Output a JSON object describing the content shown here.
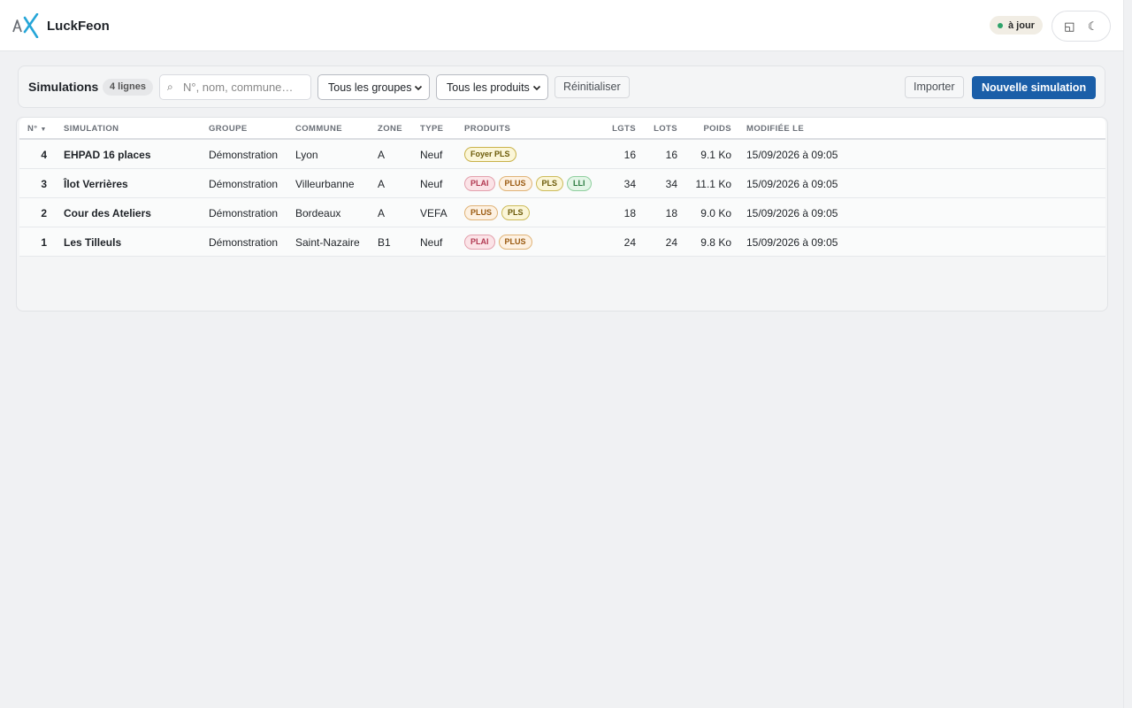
{
  "app": {
    "name": "LuckFeon"
  },
  "header": {
    "status": "à jour",
    "status_color": "#2ea36a",
    "icons": [
      "layout-icon",
      "moon-icon"
    ]
  },
  "toolbar": {
    "title": "Simulations",
    "count": "4 lignes",
    "search_placeholder": "N°, nom, commune…",
    "group_filter": "Tous les groupes",
    "product_filter": "Tous les produits",
    "reset_label": "Réinitialiser",
    "import_label": "Importer",
    "new_label": "Nouvelle simulation",
    "primary_color": "#1a5ea8"
  },
  "table": {
    "columns": [
      "N°",
      "SIMULATION",
      "GROUPE",
      "COMMUNE",
      "ZONE",
      "TYPE",
      "PRODUITS",
      "LGTS",
      "LOTS",
      "POIDS",
      "MODIFIÉE LE"
    ],
    "rows": [
      {
        "num": "4",
        "name": "EHPAD 16 places",
        "group": "Démonstration",
        "commune": "Lyon",
        "zone": "A",
        "type": "Neuf",
        "products": [
          "Foyer PLS"
        ],
        "lgts": "16",
        "lots": "16",
        "poids": "9.1 Ko",
        "modified": "15/09/2026 à 09:05"
      },
      {
        "num": "3",
        "name": "Îlot Verrières",
        "group": "Démonstration",
        "commune": "Villeurbanne",
        "zone": "A",
        "type": "Neuf",
        "products": [
          "PLAI",
          "PLUS",
          "PLS",
          "LLI"
        ],
        "lgts": "34",
        "lots": "34",
        "poids": "11.1 Ko",
        "modified": "15/09/2026 à 09:05"
      },
      {
        "num": "2",
        "name": "Cour des Ateliers",
        "group": "Démonstration",
        "commune": "Bordeaux",
        "zone": "A",
        "type": "VEFA",
        "products": [
          "PLUS",
          "PLS"
        ],
        "lgts": "18",
        "lots": "18",
        "poids": "9.0 Ko",
        "modified": "15/09/2026 à 09:05"
      },
      {
        "num": "1",
        "name": "Les Tilleuls",
        "group": "Démonstration",
        "commune": "Saint-Nazaire",
        "zone": "B1",
        "type": "Neuf",
        "products": [
          "PLAI",
          "PLUS"
        ],
        "lgts": "24",
        "lots": "24",
        "poids": "9.8 Ko",
        "modified": "15/09/2026 à 09:05"
      }
    ]
  },
  "tag_colors": {
    "Foyer PLS": {
      "bg": "#fbf6d8",
      "border": "#c9b24a",
      "fg": "#6b5a08"
    },
    "PLAI": {
      "bg": "#fbe3e7",
      "border": "#e3a0ad",
      "fg": "#b23a52"
    },
    "PLUS": {
      "bg": "#fdf1e2",
      "border": "#e0b377",
      "fg": "#9a5a10"
    },
    "PLS": {
      "bg": "#fbf6d8",
      "border": "#cdbb5a",
      "fg": "#6b5a08"
    },
    "LLI": {
      "bg": "#e3f5e7",
      "border": "#8fcf9e",
      "fg": "#2a7a3f"
    }
  }
}
